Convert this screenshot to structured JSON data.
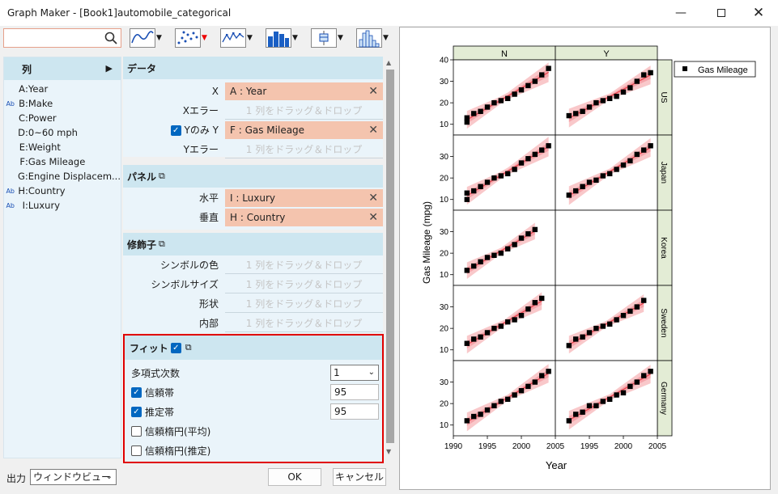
{
  "window": {
    "title": "Graph Maker - [Book1]automobile_categorical",
    "controls": [
      "minimize",
      "maximize",
      "close"
    ]
  },
  "toolbar": {
    "search_value": "",
    "search_placeholder": "",
    "plot_types": [
      "line-plot",
      "scatter-plot",
      "line-symbol-plot",
      "column-plot",
      "box-plot",
      "histogram-plot"
    ]
  },
  "columns": {
    "header": "列",
    "items": [
      {
        "ab": "",
        "letter": "A",
        "name": "Year"
      },
      {
        "ab": "Ab",
        "letter": "B",
        "name": "Make"
      },
      {
        "ab": "",
        "letter": "C",
        "name": "Power"
      },
      {
        "ab": "",
        "letter": "D",
        "name": "0~60 mph"
      },
      {
        "ab": "",
        "letter": "E",
        "name": "Weight"
      },
      {
        "ab": "",
        "letter": "F",
        "name": "Gas Mileage"
      },
      {
        "ab": "",
        "letter": "G",
        "name": "Engine Displacem..."
      },
      {
        "ab": "Ab",
        "letter": "H",
        "name": "Country"
      },
      {
        "ab": "Ab",
        "letter": "I",
        "name": "Luxury"
      }
    ]
  },
  "data_section": {
    "title": "データ",
    "x_label": "X",
    "x_value": "A : Year",
    "xerr_label": "Xエラー",
    "xerr_placeholder": "1 列をドラッグ＆ドロップ",
    "y_label": "Yのみ Y",
    "y_checked": true,
    "y_value": "F : Gas Mileage",
    "yerr_label": "Yエラー",
    "yerr_placeholder": "1 列をドラッグ＆ドロップ"
  },
  "panel_section": {
    "title": "パネル",
    "horizontal_label": "水平",
    "horizontal_value": "I : Luxury",
    "vertical_label": "垂直",
    "vertical_value": "H : Country"
  },
  "modifier_section": {
    "title": "修飾子",
    "rows": [
      {
        "label": "シンボルの色",
        "placeholder": "1 列をドラッグ＆ドロップ"
      },
      {
        "label": "シンボルサイズ",
        "placeholder": "1 列をドラッグ＆ドロップ"
      },
      {
        "label": "形状",
        "placeholder": "1 列をドラッグ＆ドロップ"
      },
      {
        "label": "内部",
        "placeholder": "1 列をドラッグ＆ドロップ"
      }
    ]
  },
  "fit_section": {
    "title": "フィット",
    "enabled": true,
    "poly_order_label": "多項式次数",
    "poly_order_value": "1",
    "confidence_band_label": "信頼帯",
    "confidence_band_checked": true,
    "confidence_band_value": "95",
    "prediction_band_label": "推定帯",
    "prediction_band_checked": true,
    "prediction_band_value": "95",
    "conf_ellipse_mean_label": "信頼楕円(平均)",
    "conf_ellipse_mean_checked": false,
    "conf_ellipse_pred_label": "信頼楕円(推定)",
    "conf_ellipse_pred_checked": false
  },
  "footer": {
    "output_label": "出力",
    "output_value": "ウィンドウビュー",
    "ok_label": "OK",
    "cancel_label": "キャンセル"
  },
  "colors": {
    "accent_check": "#0067c0",
    "slot_filled": "#f4c4ae",
    "section_header": "#cde6f0",
    "panel_bg": "#eaf4fa",
    "highlight_border": "#e00000",
    "strip_bg": "#e3ecd5",
    "fit_line": "#e8404a",
    "band": "#f7b5b8"
  },
  "chart_data": {
    "type": "scatter",
    "title": "",
    "xlabel": "Year",
    "ylabel": "Gas Mileage (mpg)",
    "xlim": [
      1990,
      2005
    ],
    "x_ticks": [
      "1990",
      "1995",
      "2000",
      "2005"
    ],
    "ylim": [
      5,
      40
    ],
    "y_ticks": [
      "10",
      "20",
      "30",
      "40"
    ],
    "col_strips": [
      "N",
      "Y"
    ],
    "row_strips": [
      "US",
      "Japan",
      "Korea",
      "Sweden",
      "Germany"
    ],
    "legend": "Gas Mileage",
    "panels": [
      {
        "row": "US",
        "col": "N",
        "x": [
          1992,
          1992,
          1993,
          1994,
          1995,
          1996,
          1997,
          1998,
          1999,
          2000,
          2001,
          2002,
          2003,
          2004
        ],
        "y": [
          11,
          13,
          15,
          16,
          18,
          20,
          21,
          22,
          24,
          26,
          28,
          30,
          33,
          36
        ]
      },
      {
        "row": "US",
        "col": "Y",
        "x": [
          1992,
          1993,
          1994,
          1995,
          1996,
          1997,
          1998,
          1999,
          2000,
          2001,
          2002,
          2003,
          2004
        ],
        "y": [
          14,
          15,
          16,
          18,
          20,
          21,
          22,
          23,
          25,
          27,
          30,
          33,
          34
        ]
      },
      {
        "row": "Japan",
        "col": "N",
        "x": [
          1992,
          1992,
          1993,
          1994,
          1995,
          1996,
          1997,
          1998,
          1999,
          2000,
          2001,
          2002,
          2003,
          2004
        ],
        "y": [
          10,
          13,
          14,
          16,
          18,
          20,
          21,
          22,
          24,
          27,
          29,
          31,
          33,
          35
        ]
      },
      {
        "row": "Japan",
        "col": "Y",
        "x": [
          1992,
          1993,
          1994,
          1995,
          1996,
          1997,
          1998,
          1999,
          2000,
          2001,
          2002,
          2003,
          2004
        ],
        "y": [
          12,
          14,
          16,
          18,
          19,
          21,
          22,
          24,
          26,
          28,
          31,
          33,
          35
        ]
      },
      {
        "row": "Korea",
        "col": "N",
        "x": [
          1992,
          1993,
          1994,
          1995,
          1996,
          1997,
          1998,
          1999,
          2000,
          2001,
          2002
        ],
        "y": [
          12,
          14,
          16,
          18,
          19,
          20,
          22,
          24,
          27,
          29,
          31
        ]
      },
      {
        "row": "Sweden",
        "col": "N",
        "x": [
          1992,
          1993,
          1994,
          1995,
          1996,
          1997,
          1998,
          1999,
          2000,
          2001,
          2002,
          2003
        ],
        "y": [
          13,
          15,
          16,
          18,
          20,
          21,
          23,
          24,
          26,
          29,
          32,
          34
        ]
      },
      {
        "row": "Sweden",
        "col": "Y",
        "x": [
          1992,
          1993,
          1994,
          1995,
          1996,
          1997,
          1998,
          1999,
          2000,
          2001,
          2002,
          2003
        ],
        "y": [
          12,
          15,
          16,
          18,
          20,
          21,
          22,
          24,
          26,
          28,
          30,
          33
        ]
      },
      {
        "row": "Germany",
        "col": "N",
        "x": [
          1992,
          1993,
          1994,
          1995,
          1996,
          1997,
          1998,
          1999,
          2000,
          2001,
          2002,
          2003,
          2004
        ],
        "y": [
          12,
          14,
          15,
          17,
          19,
          21,
          22,
          24,
          26,
          28,
          30,
          33,
          35
        ]
      },
      {
        "row": "Germany",
        "col": "Y",
        "x": [
          1992,
          1993,
          1994,
          1995,
          1996,
          1997,
          1998,
          1999,
          2000,
          2001,
          2002,
          2003,
          2004
        ],
        "y": [
          12,
          15,
          16,
          19,
          19,
          21,
          22,
          24,
          25,
          28,
          30,
          33,
          35
        ]
      }
    ]
  }
}
